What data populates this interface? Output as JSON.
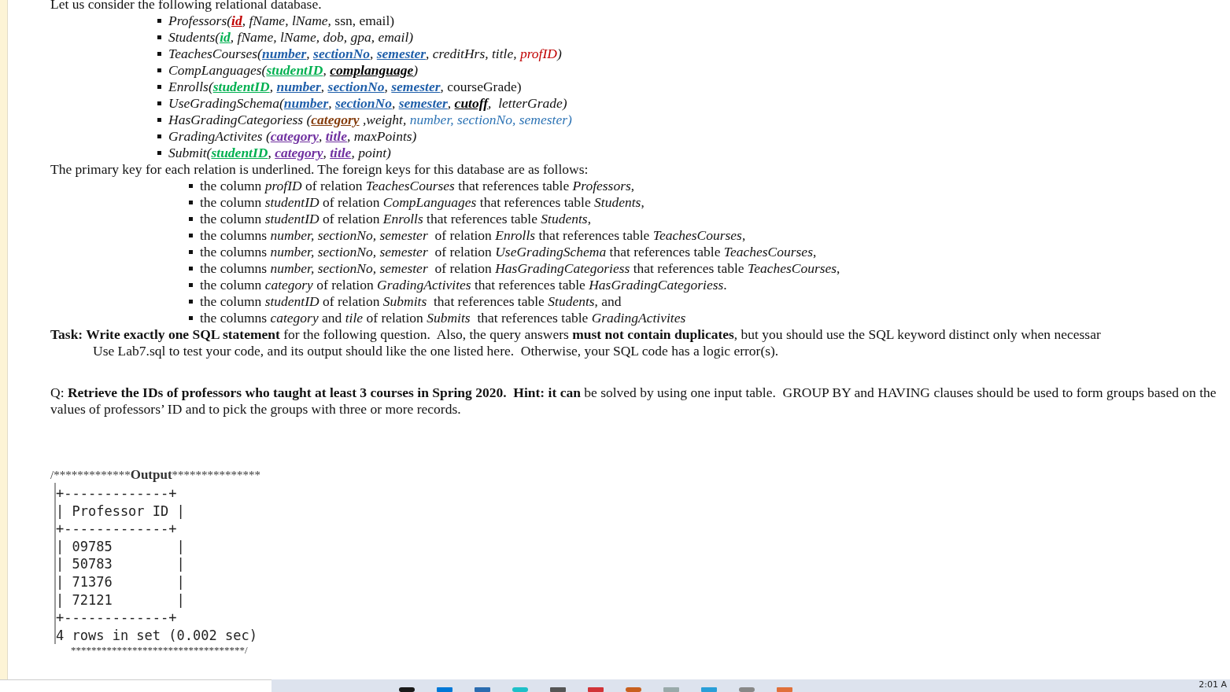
{
  "intro": "Let us consider the following relational database.",
  "relations": [
    [
      {
        "t": "Professors(",
        "kind": "italic"
      },
      {
        "t": "id",
        "kind": "key",
        "color": "#c00000"
      },
      {
        "t": ", fName, lName,",
        "kind": "italic"
      },
      {
        "t": " ssn, email)",
        "kind": "plain"
      }
    ],
    [
      {
        "t": "Students(",
        "kind": "italic"
      },
      {
        "t": "id",
        "kind": "key",
        "color": "#00b050"
      },
      {
        "t": ", fName, lName, dob, gpa, email)",
        "kind": "italic"
      }
    ],
    [
      {
        "t": "TeachesCourses(",
        "kind": "italic"
      },
      {
        "t": "number",
        "kind": "key",
        "color": "#1f5faa"
      },
      {
        "t": ", ",
        "kind": "italic"
      },
      {
        "t": "sectionNo",
        "kind": "key",
        "color": "#1f5faa"
      },
      {
        "t": ", ",
        "kind": "italic"
      },
      {
        "t": "semester",
        "kind": "key",
        "color": "#1f5faa"
      },
      {
        "t": ", creditHrs, title, ",
        "kind": "italic"
      },
      {
        "t": "profID",
        "kind": "italic",
        "color": "#c00000"
      },
      {
        "t": ")",
        "kind": "italic"
      }
    ],
    [
      {
        "t": "CompLanguages(",
        "kind": "italic"
      },
      {
        "t": "studentID",
        "kind": "key",
        "color": "#00b050"
      },
      {
        "t": ", ",
        "kind": "italic"
      },
      {
        "t": "complanguage",
        "kind": "key",
        "color": "#000000"
      },
      {
        "t": ")",
        "kind": "italic"
      }
    ],
    [
      {
        "t": "Enrolls(",
        "kind": "italic"
      },
      {
        "t": "studentID",
        "kind": "key",
        "color": "#00b050"
      },
      {
        "t": ", ",
        "kind": "italic"
      },
      {
        "t": "number",
        "kind": "key",
        "color": "#1f5faa"
      },
      {
        "t": ", ",
        "kind": "italic"
      },
      {
        "t": "sectionNo",
        "kind": "key",
        "color": "#1f5faa"
      },
      {
        "t": ", ",
        "kind": "italic"
      },
      {
        "t": "semester",
        "kind": "key",
        "color": "#1f5faa"
      },
      {
        "t": ", courseGrade)",
        "kind": "plain"
      }
    ],
    [
      {
        "t": "UseGradingSchema(",
        "kind": "italic"
      },
      {
        "t": "number",
        "kind": "key",
        "color": "#1f5faa"
      },
      {
        "t": ", ",
        "kind": "italic"
      },
      {
        "t": "sectionNo",
        "kind": "key",
        "color": "#1f5faa"
      },
      {
        "t": ", ",
        "kind": "italic"
      },
      {
        "t": "semester",
        "kind": "key",
        "color": "#1f5faa"
      },
      {
        "t": ", ",
        "kind": "italic"
      },
      {
        "t": "cutoff",
        "kind": "key",
        "color": "#000000"
      },
      {
        "t": ",  letterGrade)",
        "kind": "italic"
      }
    ],
    [
      {
        "t": "HasGradingCategoriess (",
        "kind": "italic"
      },
      {
        "t": "category",
        "kind": "key",
        "color": "#843c0c"
      },
      {
        "t": " ,weight, ",
        "kind": "italic"
      },
      {
        "t": "number, sectionNo, semester)",
        "kind": "italic",
        "color": "#2e74b5"
      }
    ],
    [
      {
        "t": "GradingActivites (",
        "kind": "italic"
      },
      {
        "t": "category",
        "kind": "key",
        "color": "#7030a0"
      },
      {
        "t": ", ",
        "kind": "italic"
      },
      {
        "t": "title",
        "kind": "key",
        "color": "#7030a0"
      },
      {
        "t": ", maxPoints)",
        "kind": "italic"
      }
    ],
    [
      {
        "t": "Submit(",
        "kind": "italic"
      },
      {
        "t": "studentID",
        "kind": "key",
        "color": "#00b050"
      },
      {
        "t": ", ",
        "kind": "italic"
      },
      {
        "t": "category",
        "kind": "key",
        "color": "#7030a0"
      },
      {
        "t": ", ",
        "kind": "italic"
      },
      {
        "t": "title",
        "kind": "key",
        "color": "#7030a0"
      },
      {
        "t": ", point)",
        "kind": "italic"
      }
    ]
  ],
  "fk_intro": "The primary key for each relation is underlined. The foreign keys for this database are as follows:",
  "foreign_keys": [
    "the column *profID* of relation *TeachesCourses* that references table *Professors*,",
    "the column *studentID* of relation *CompLanguages* that references table *Students*,",
    "the column *studentID* of relation *Enrolls* that references table *Students*,",
    "the columns *number, sectionNo, semester*  of relation *Enrolls* that references table *TeachesCourses*,",
    "the columns *number, sectionNo, semester*  of relation *UseGradingSchema* that references table *TeachesCourses*,",
    "the columns *number, sectionNo, semester*  of relation *HasGradingCategoriess* that references table *TeachesCourses*,",
    "the column *category* of relation *GradingActivites* that references table *HasGradingCategoriess*.",
    "the column *studentID* of relation *Submits*  that references table *Students*, and",
    "the columns *category* and *tile* of relation *Submits*  that references table *GradingActivites*"
  ],
  "task": [
    "**Task: Write exactly one SQL statement** for the following question.  Also, the query answers **must not contain duplicates**, but you should use the SQL keyword distinct only when necessar",
    "Use Lab7.sql to test your code, and its output should like the one listed here.  Otherwise, your SQL code has a logic error(s)."
  ],
  "question": "Q: **Retrieve the IDs of professors who taught at least 3 courses in Spring 2020.  Hint: it can** be solved by using one input table.  GROUP BY and HAVING clauses should be used to form groups based on the values of professors’ ID and to pick the groups with three or more records.",
  "output_header": {
    "prefix": "/*************",
    "title": "Output",
    "suffix": "***************"
  },
  "console": [
    "+-------------+",
    "| Professor ID |",
    "+-------------+",
    "| 09785        |",
    "| 50783        |",
    "| 71376        |",
    "| 72121        |",
    "+-------------+",
    "4 rows in set (0.002 sec)"
  ],
  "output_footer": "**********************************/",
  "taskbar": {
    "clock": "2:01 A"
  }
}
